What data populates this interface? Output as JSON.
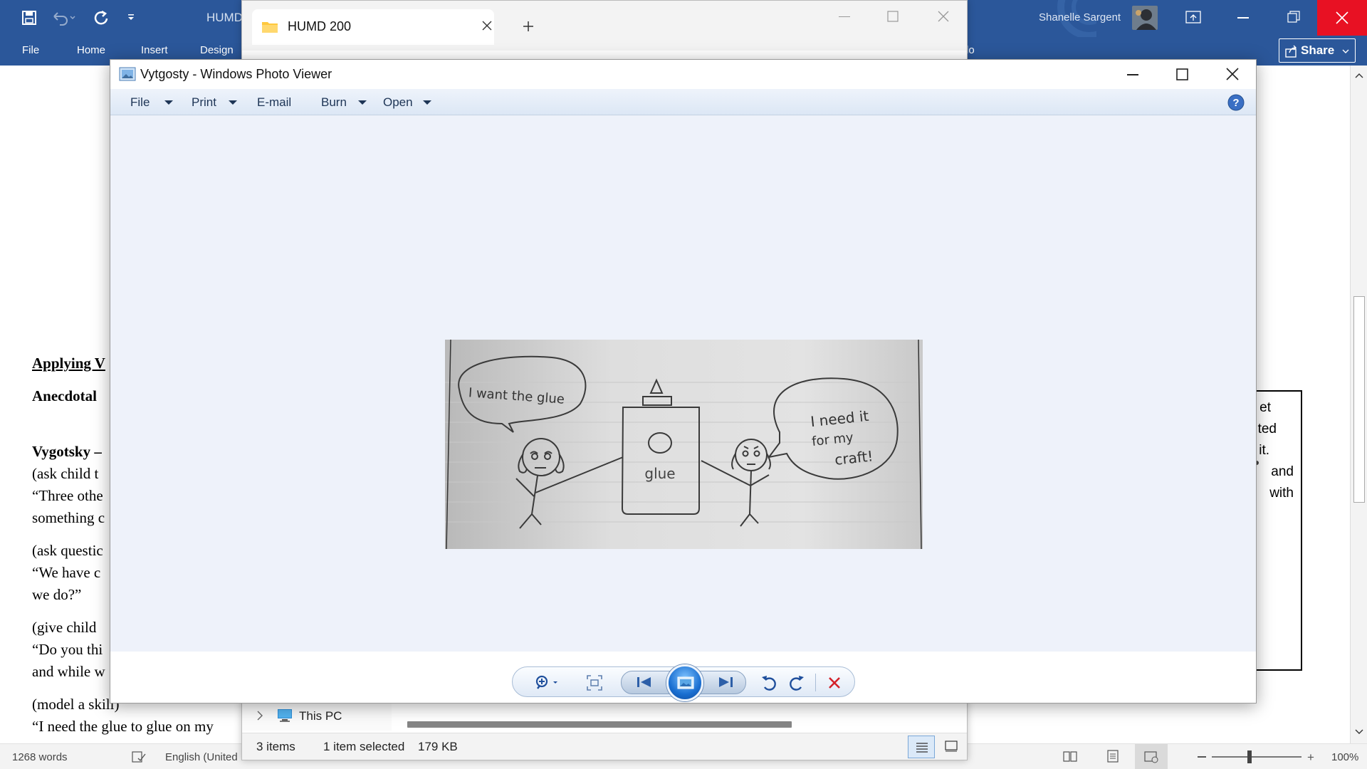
{
  "word": {
    "user_name": "Shanelle Sargent",
    "share_label": "Share",
    "title_partial": "HUMD",
    "tabs": [
      "File",
      "Home",
      "Insert",
      "Design"
    ],
    "tab_partial_right": "lo",
    "doc_lines": {
      "heading": "Applying V",
      "anecdotal": "Anecdotal",
      "vygotsky": "Vygotsky –",
      "l1": "(ask child t",
      "l2": "“Three othe",
      "l3": "something c",
      "l4": "(ask questic",
      "l5": "“We have c",
      "l6": "we do?”",
      "l7": "(give child",
      "l8": "“Do you thi",
      "l9": "and while w",
      "l10": "(model a skill)",
      "l11": "“I need the glue to glue on my"
    },
    "sidebar_box_lines": [
      "et",
      "ted",
      "it.",
      "and",
      "with"
    ],
    "status": {
      "word_count": "1268 words",
      "language": "English (United",
      "zoom": "100%"
    }
  },
  "explorer": {
    "tab_title": "HUMD 200",
    "nav_item": "This PC",
    "status": {
      "items": "3 items",
      "selected": "1 item selected",
      "size": "179 KB"
    }
  },
  "photo_viewer": {
    "title": "Vytgosty - Windows Photo Viewer",
    "menu": [
      "File",
      "Print",
      "E-mail",
      "Burn",
      "Open"
    ],
    "drawing_text": {
      "left_bubble": "I want the glue",
      "right_bubble_1": "I need it",
      "right_bubble_2": "for my",
      "right_bubble_3": "craft!",
      "bottle_label": "glue"
    }
  },
  "colors": {
    "word_blue": "#2b579a",
    "close_red": "#e81123",
    "viewer_bg": "#eef2fa"
  }
}
